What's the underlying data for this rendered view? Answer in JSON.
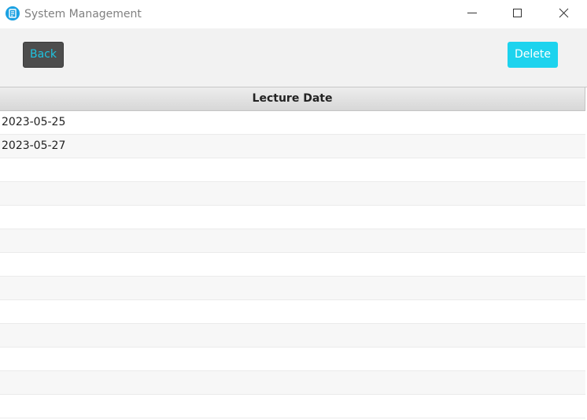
{
  "window": {
    "title": "System Management",
    "icon": "document-app-icon",
    "controls": {
      "minimize_icon": "minimize-icon",
      "maximize_icon": "maximize-icon",
      "close_icon": "close-icon"
    }
  },
  "toolbar": {
    "back_label": "Back",
    "delete_label": "Delete",
    "back_text_color": "#1ec3e0",
    "back_bg_color": "#4d4d4d",
    "delete_bg_color": "#1dd3ee"
  },
  "table": {
    "columns": [
      "Lecture Date"
    ],
    "rows": [
      [
        "2023-05-25"
      ],
      [
        "2023-05-27"
      ]
    ]
  }
}
